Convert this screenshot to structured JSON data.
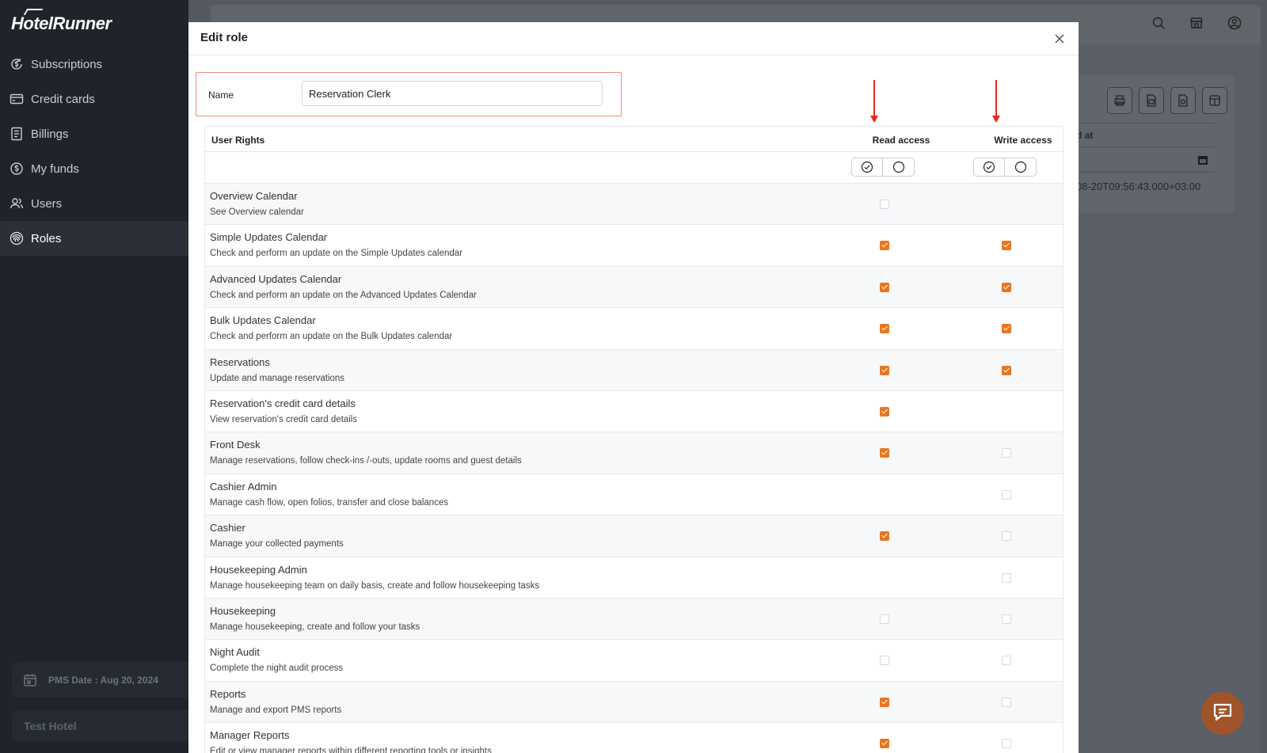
{
  "brand": {
    "logo_text": "HotelRunner",
    "accent": "#e8761f"
  },
  "sidebar": {
    "items": [
      {
        "label": "Subscriptions",
        "icon": "dollar-cycle-icon",
        "active": false
      },
      {
        "label": "Credit cards",
        "icon": "credit-card-icon",
        "active": false
      },
      {
        "label": "Billings",
        "icon": "document-icon",
        "active": false
      },
      {
        "label": "My funds",
        "icon": "dollar-circle-icon",
        "active": false
      },
      {
        "label": "Users",
        "icon": "users-icon",
        "active": false
      },
      {
        "label": "Roles",
        "icon": "fingerprint-icon",
        "active": true
      }
    ],
    "pms_date": "PMS Date : Aug 20, 2024",
    "hotel_name": "Test Hotel"
  },
  "background": {
    "column_header": "d at",
    "cell_value": "08-20T09:56:43.000+03:00"
  },
  "modal": {
    "title": "Edit role",
    "name_label": "Name",
    "name_value": "Reservation Clerk",
    "headers": {
      "rights": "User Rights",
      "read": "Read access",
      "write": "Write access"
    },
    "rows": [
      {
        "title": "Overview Calendar",
        "desc": "See Overview calendar",
        "read": false,
        "write": null
      },
      {
        "title": "Simple Updates Calendar",
        "desc": "Check and perform an update on the Simple Updates calendar",
        "read": true,
        "write": true
      },
      {
        "title": "Advanced Updates Calendar",
        "desc": "Check and perform an update on the Advanced Updates Calendar",
        "read": true,
        "write": true
      },
      {
        "title": "Bulk Updates Calendar",
        "desc": "Check and perform an update on the Bulk Updates calendar",
        "read": true,
        "write": true
      },
      {
        "title": "Reservations",
        "desc": "Update and manage reservations",
        "read": true,
        "write": true
      },
      {
        "title": "Reservation's credit card details",
        "desc": "View reservation's credit card details",
        "read": true,
        "write": null
      },
      {
        "title": "Front Desk",
        "desc": "Manage reservations, follow check-ins /-outs, update rooms and guest details",
        "read": true,
        "write": false
      },
      {
        "title": "Cashier Admin",
        "desc": "Manage cash flow, open folios, transfer and close balances",
        "read": null,
        "write": false
      },
      {
        "title": "Cashier",
        "desc": "Manage your collected payments",
        "read": true,
        "write": false
      },
      {
        "title": "Housekeeping Admin",
        "desc": "Manage housekeeping team on daily basis, create and follow housekeeping tasks",
        "read": null,
        "write": false
      },
      {
        "title": "Housekeeping",
        "desc": "Manage housekeeping, create and follow your tasks",
        "read": false,
        "write": false
      },
      {
        "title": "Night Audit",
        "desc": "Complete the night audit process",
        "read": false,
        "write": false
      },
      {
        "title": "Reports",
        "desc": "Manage and export PMS reports",
        "read": true,
        "write": false
      },
      {
        "title": "Manager Reports",
        "desc": "Edit or view manager reports within different reporting tools or insights",
        "read": true,
        "write": false
      }
    ]
  }
}
